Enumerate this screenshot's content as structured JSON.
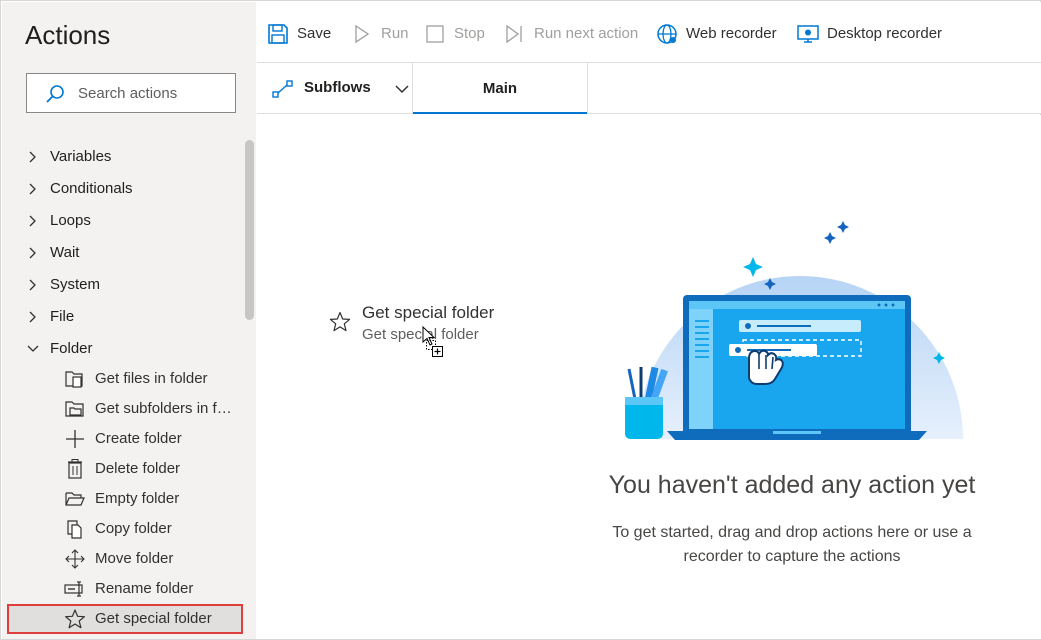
{
  "actions_panel": {
    "title": "Actions",
    "search_placeholder": "Search actions",
    "categories": [
      {
        "label": "Variables",
        "icon": "chevron-right-icon"
      },
      {
        "label": "Conditionals",
        "icon": "chevron-right-icon"
      },
      {
        "label": "Loops",
        "icon": "chevron-right-icon"
      },
      {
        "label": "Wait",
        "icon": "chevron-right-icon"
      },
      {
        "label": "System",
        "icon": "chevron-right-icon"
      },
      {
        "label": "File",
        "icon": "chevron-right-icon"
      },
      {
        "label": "Folder",
        "icon": "chevron-down-icon"
      }
    ],
    "folder_actions": [
      {
        "label": "Get files in folder",
        "icon": "files-icon"
      },
      {
        "label": "Get subfolders in folder",
        "icon": "subfolders-icon"
      },
      {
        "label": "Create folder",
        "icon": "plus-icon"
      },
      {
        "label": "Delete folder",
        "icon": "trash-icon"
      },
      {
        "label": "Empty folder",
        "icon": "open-folder-icon"
      },
      {
        "label": "Copy folder",
        "icon": "copy-icon"
      },
      {
        "label": "Move folder",
        "icon": "move-icon"
      },
      {
        "label": "Rename folder",
        "icon": "rename-icon"
      },
      {
        "label": "Get special folder",
        "icon": "star-icon"
      }
    ],
    "selected_item": "Get special folder"
  },
  "toolbar": {
    "save": "Save",
    "run": "Run",
    "stop": "Stop",
    "run_next": "Run next action",
    "web_recorder": "Web recorder",
    "desktop_recorder": "Desktop recorder"
  },
  "tabs": {
    "subflows": "Subflows",
    "main": "Main"
  },
  "drag_preview": {
    "title": "Get special folder",
    "subtitle": "Get special folder"
  },
  "empty_state": {
    "title": "You haven't added any action yet",
    "description": "To get started, drag and drop actions here or use a recorder to capture the actions"
  },
  "colors": {
    "accent": "#0078d4",
    "selection_border": "#e03d3d",
    "panel_bg": "#f3f2f1"
  }
}
